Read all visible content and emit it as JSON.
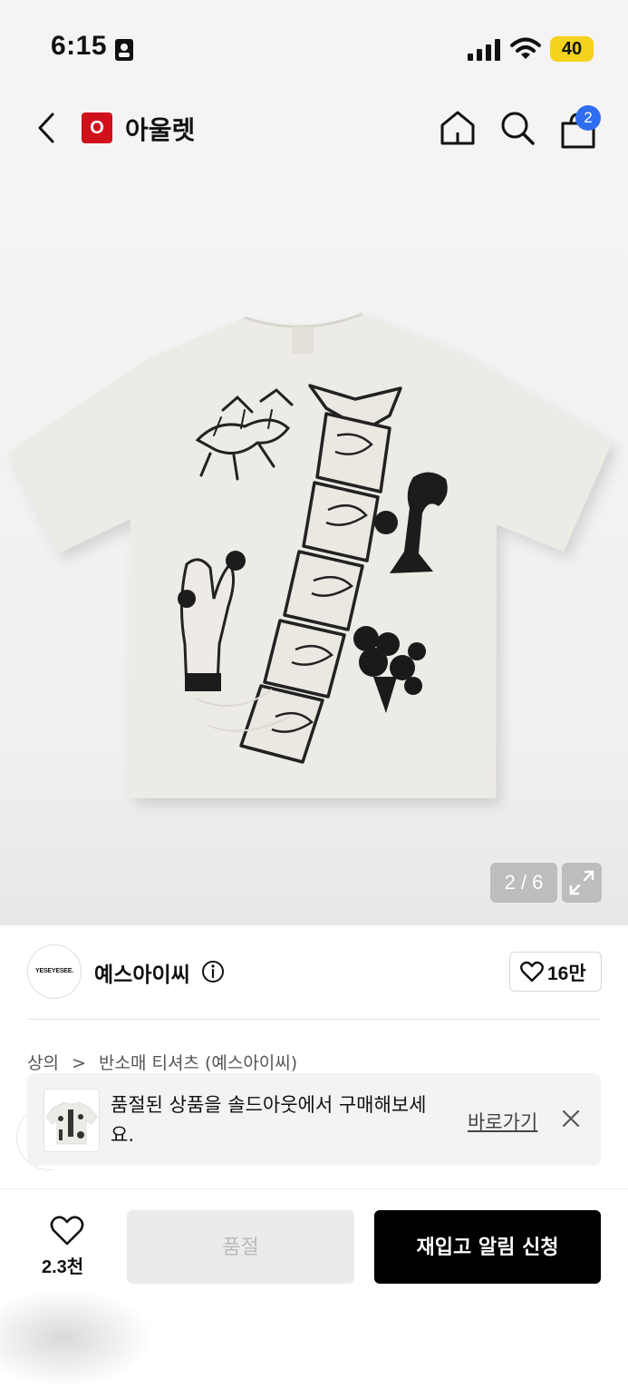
{
  "status_bar": {
    "time": "6:15",
    "battery": "40"
  },
  "header": {
    "logo_letter": "O",
    "title": "아울렛",
    "cart_count": "2"
  },
  "gallery": {
    "counter": "2 / 6"
  },
  "brand": {
    "logo_text": "YESEYESEE.",
    "name": "예스아이씨",
    "likes": "16만"
  },
  "breadcrumb": {
    "category": "상의",
    "separator": ">",
    "subcategory": "반소매 티셔츠 (예스아이씨)"
  },
  "toast": {
    "line1": "품절된 상품을 솔드아웃에서 구매해보세",
    "line2": "요.",
    "link": "바로가기"
  },
  "bottom_bar": {
    "wish_count": "2.3천",
    "soldout_label": "품절",
    "restock_label": "재입고 알림 신청"
  },
  "colors": {
    "brand_red": "#d0111b",
    "badge_blue": "#2f6df0",
    "battery_yellow": "#f5d21c",
    "cta_black": "#000000"
  }
}
